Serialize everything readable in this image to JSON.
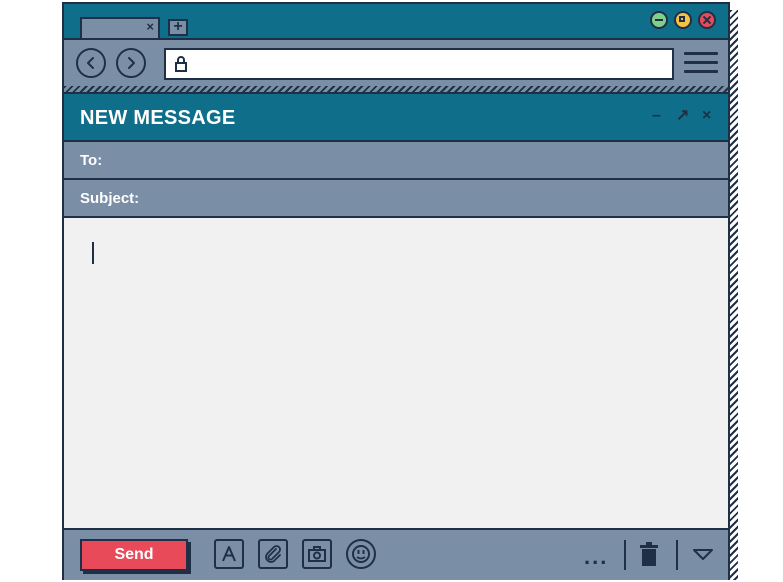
{
  "browser": {
    "tab_close": "×",
    "new_tab": "+",
    "address_value": ""
  },
  "message": {
    "title": "NEW MESSAGE",
    "minimize": "–",
    "expand": "↗",
    "close": "×"
  },
  "fields": {
    "to_label": "To:",
    "to_value": "",
    "subject_label": "Subject:",
    "subject_value": ""
  },
  "footer": {
    "send_label": "Send",
    "more_label": "..."
  },
  "icons": {
    "back": "chevron-left-icon",
    "forward": "chevron-right-icon",
    "lock": "lock-icon",
    "menu": "hamburger-icon",
    "format": "text-format-icon",
    "attach": "paperclip-icon",
    "photo": "camera-icon",
    "emoji": "emoji-icon",
    "trash": "trash-icon",
    "dropdown": "chevron-down-icon"
  },
  "colors": {
    "header_teal": "#0f6f8a",
    "panel_slate": "#7a8fa6",
    "outline_navy": "#1f2f45",
    "send_red": "#e84a5a",
    "body_bg": "#f1f1f2"
  }
}
